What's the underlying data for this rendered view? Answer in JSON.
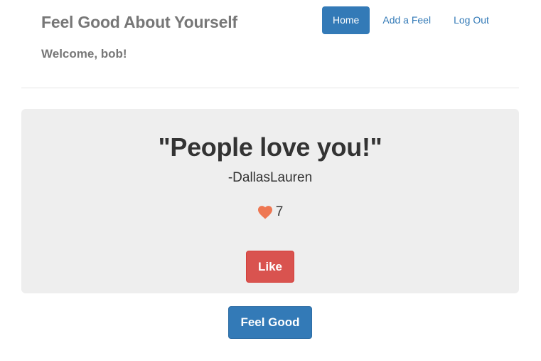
{
  "header": {
    "brand": "Feel Good About Yourself",
    "welcome": "Welcome, bob!"
  },
  "nav": {
    "items": [
      {
        "label": "Home",
        "active": true
      },
      {
        "label": "Add a Feel",
        "active": false
      },
      {
        "label": "Log Out",
        "active": false
      }
    ]
  },
  "feel": {
    "quote": "\"People love you!\"",
    "author": "-DallasLauren",
    "likes": "7",
    "like_button": "Like"
  },
  "actions": {
    "feel_good_button": "Feel Good"
  },
  "icons": {
    "like_count": "heart-icon"
  },
  "colors": {
    "primary": "#337ab7",
    "danger": "#d9534f",
    "heart": "#ee7752",
    "jumbotron_bg": "#eeeeee",
    "muted_text": "#777777"
  }
}
